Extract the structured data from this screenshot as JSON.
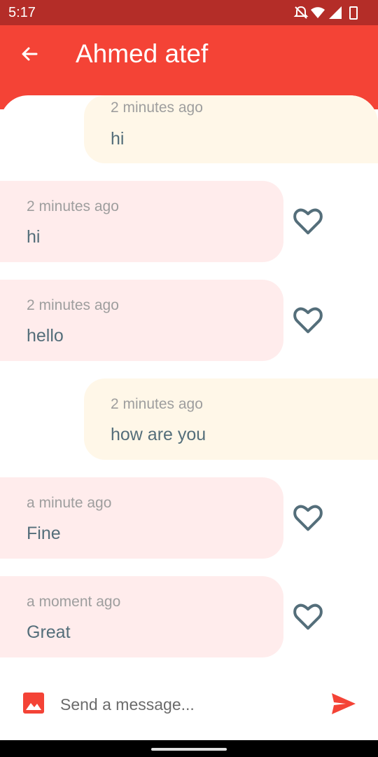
{
  "status": {
    "time": "5:17"
  },
  "app_bar": {
    "title": "Ahmed atef",
    "back_icon": "arrow-back-icon"
  },
  "messages": [
    {
      "direction": "sent",
      "timestamp": "2 minutes ago",
      "text": "hi"
    },
    {
      "direction": "received",
      "timestamp": "2 minutes ago",
      "text": "hi",
      "liked": false
    },
    {
      "direction": "received",
      "timestamp": "2 minutes ago",
      "text": "hello",
      "liked": false
    },
    {
      "direction": "sent",
      "timestamp": "2 minutes ago",
      "text": "how are you"
    },
    {
      "direction": "received",
      "timestamp": "a minute ago",
      "text": "Fine",
      "liked": false
    },
    {
      "direction": "received",
      "timestamp": "a moment ago",
      "text": "Great",
      "liked": false
    }
  ],
  "composer": {
    "placeholder": "Send a message...",
    "value": "",
    "image_icon": "image-icon",
    "send_icon": "send-icon"
  },
  "colors": {
    "app_bar": "#f44336",
    "status_bar": "#b42d28",
    "sent_bubble": "#fff7e8",
    "received_bubble": "#ffecec",
    "message_text": "#546e7a",
    "timestamp_text": "#9e9e9e",
    "heart_icon": "#546e7a"
  }
}
